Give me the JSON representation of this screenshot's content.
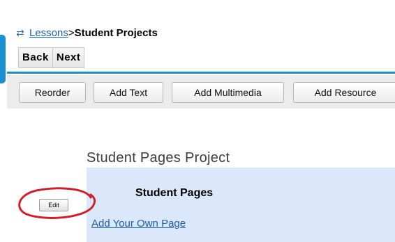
{
  "breadcrumb": {
    "link": "Lessons",
    "separator": ">",
    "current": "Student Projects"
  },
  "nav": {
    "back_label": "Back",
    "next_label": "Next"
  },
  "toolbar": {
    "reorder_label": "Reorder",
    "add_text_label": "Add Text",
    "add_multimedia_label": "Add Multimedia",
    "add_resource_label": "Add Resource"
  },
  "project": {
    "title": "Student Pages Project",
    "heading": "Student Pages",
    "add_link": "Add Your Own Page",
    "edit_label": "Edit"
  },
  "colors": {
    "accent": "#1a8fd0",
    "panel": "#dbe7fb",
    "highlight": "#d0202a",
    "link": "#1b5fa8"
  },
  "icons": {
    "breadcrumb_icon": "refresh-icon"
  }
}
